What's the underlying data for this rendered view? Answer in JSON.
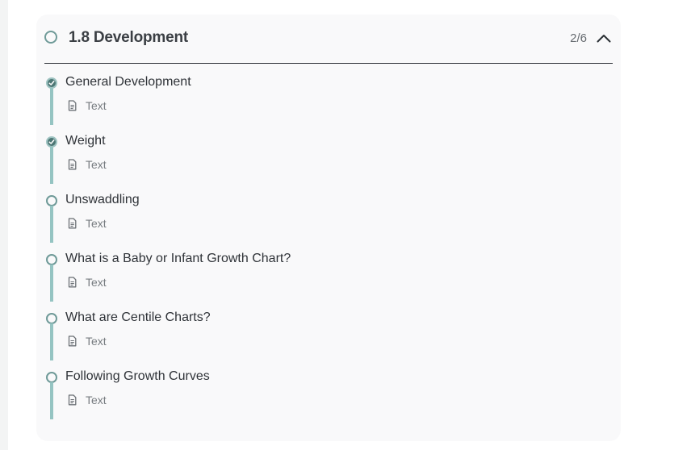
{
  "section": {
    "title": "1.8 Development",
    "progress": "2/6",
    "completed": 2,
    "total": 6,
    "expanded": true,
    "toggle_icon": "chevron-up-icon"
  },
  "colors": {
    "accent": "#6f9a98",
    "accent_light": "#95c4c2",
    "done_fill": "#4d7775",
    "card_bg": "#f9f9fa",
    "text": "#2f3338",
    "muted": "#777c80"
  },
  "lessons": [
    {
      "title": "General Development",
      "type": "Text",
      "type_icon": "document-icon",
      "completed": true
    },
    {
      "title": "Weight",
      "type": "Text",
      "type_icon": "document-icon",
      "completed": true
    },
    {
      "title": "Unswaddling",
      "type": "Text",
      "type_icon": "document-icon",
      "completed": false
    },
    {
      "title": "What is a Baby or Infant Growth Chart?",
      "type": "Text",
      "type_icon": "document-icon",
      "completed": false
    },
    {
      "title": "What are Centile Charts?",
      "type": "Text",
      "type_icon": "document-icon",
      "completed": false
    },
    {
      "title": "Following Growth Curves",
      "type": "Text",
      "type_icon": "document-icon",
      "completed": false
    }
  ]
}
